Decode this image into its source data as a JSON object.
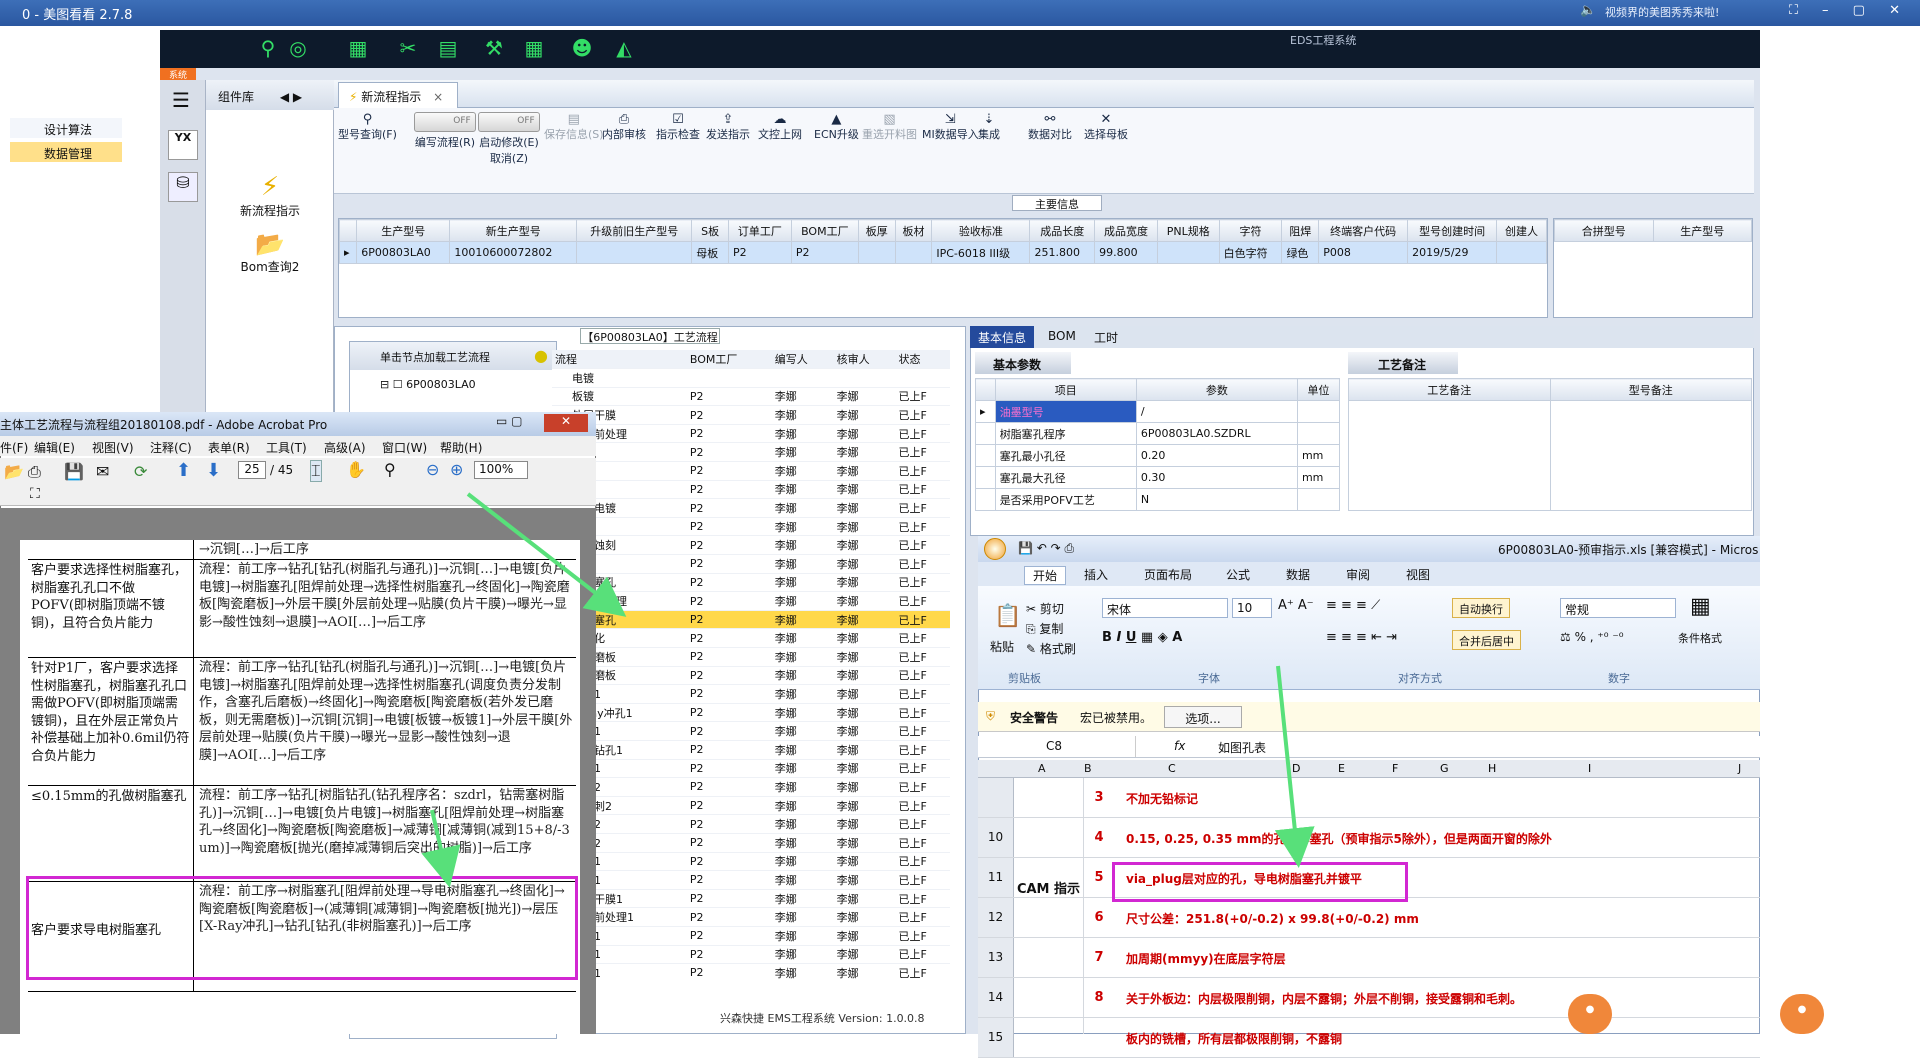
{
  "viewer": {
    "title": "0 - 美图看看 2.7.8",
    "ad_text": "视频界的美图秀秀来啦!"
  },
  "app": {
    "system_name": "EDS工程系统",
    "sys_tab": "系统",
    "status_text": "兴森快捷 EMS工程系统 Version: 1.0.0.8"
  },
  "left_nav": {
    "panel_title": "组件库",
    "items": [
      "设计算法",
      "数据管理"
    ],
    "big_buttons": [
      "新流程指示",
      "Bom查询2"
    ]
  },
  "tab": {
    "label": "新流程指示"
  },
  "ribbon": {
    "buttons": [
      {
        "label": "型号查询(F)",
        "icon": "⚲",
        "disabled": false
      },
      {
        "label": "编写流程(R)",
        "icon": "",
        "disabled": false
      },
      {
        "label": "启动修改(E)",
        "icon": "",
        "disabled": false
      },
      {
        "label": "保存信息(S)",
        "icon": "▤",
        "disabled": true
      },
      {
        "label": "内部审核",
        "icon": "⎙",
        "disabled": false
      },
      {
        "label": "指示检查",
        "icon": "☑",
        "disabled": false
      },
      {
        "label": "发送指示",
        "icon": "⇪",
        "disabled": false
      },
      {
        "label": "文控上网",
        "icon": "☁",
        "disabled": false
      },
      {
        "label": "ECN升级",
        "icon": "▲",
        "disabled": false
      },
      {
        "label": "重选开料图",
        "icon": "▧",
        "disabled": true
      },
      {
        "label": "MI数据导入",
        "icon": "⇲",
        "disabled": false
      },
      {
        "label": "集成",
        "icon": "⇣",
        "disabled": false
      },
      {
        "label": "数据对比",
        "icon": "⚯",
        "disabled": false
      },
      {
        "label": "选择母板",
        "icon": "✕",
        "disabled": false
      }
    ],
    "toggle_off": "OFF",
    "cancel_label": "取消(Z)"
  },
  "main_info": {
    "label": "主要信息",
    "columns": [
      "生产型号",
      "新生产型号",
      "升级前旧生产型号",
      "S板",
      "订单工厂",
      "BOM工厂",
      "板厚",
      "板材",
      "验收标准",
      "成品长度",
      "成品宽度",
      "PNL规格",
      "字符",
      "阻焊",
      "终端客户代码",
      "型号创建时间",
      "创建人"
    ],
    "row": [
      "6P00803LA0",
      "10010600072802",
      "",
      "母板",
      "P2",
      "P2",
      "",
      "",
      "IPC-6018 III级",
      "251.800",
      "99.800",
      "",
      "白色字符",
      "绿色",
      "P008",
      "2019/5/29",
      ""
    ],
    "merge_columns": [
      "合拼型号",
      "生产型号"
    ]
  },
  "process": {
    "title": "【6P00803LA0】工艺流程",
    "tree_header": "单击节点加载工艺流程",
    "tree_node": "6P00803LA0",
    "columns": [
      "流程",
      "BOM工厂",
      "编写人",
      "核审人",
      "状态"
    ],
    "rows": [
      [
        "电镀",
        "",
        "",
        "",
        ""
      ],
      [
        "板镀",
        "P2",
        "李娜",
        "李娜",
        "已上F"
      ],
      [
        "外层干膜",
        "P2",
        "李娜",
        "李娜",
        "已上F"
      ],
      [
        "外层前处理",
        "P2",
        "李娜",
        "李娜",
        "已上F"
      ],
      [
        "贴膜",
        "P2",
        "李娜",
        "李娜",
        "已上F"
      ],
      [
        "曝光",
        "P2",
        "李娜",
        "李娜",
        "已上F"
      ],
      [
        "显影",
        "P2",
        "李娜",
        "李娜",
        "已上F"
      ],
      [
        "图形电镀",
        "P2",
        "李娜",
        "李娜",
        "已上F"
      ],
      [
        "镀孔",
        "P2",
        "李娜",
        "李娜",
        "已上F"
      ],
      [
        "外层蚀刻",
        "P2",
        "李娜",
        "李娜",
        "已上F"
      ],
      [
        "退膜",
        "P2",
        "李娜",
        "李娜",
        "已上F"
      ],
      [
        "树脂塞孔",
        "P2",
        "李娜",
        "李娜",
        "已上F"
      ],
      [
        "阻焊前处理",
        "P2",
        "李娜",
        "李娜",
        "已上F"
      ],
      [
        "树脂塞孔",
        "P2",
        "李娜",
        "李娜",
        "已上F"
      ],
      [
        "终固化",
        "P2",
        "李娜",
        "李娜",
        "已上F"
      ],
      [
        "陶瓷磨板",
        "P2",
        "李娜",
        "李娜",
        "已上F"
      ],
      [
        "陶瓷磨板",
        "P2",
        "李娜",
        "李娜",
        "已上F"
      ],
      [
        "层压1",
        "P2",
        "李娜",
        "李娜",
        "已上F"
      ],
      [
        "X-Ray冲孔1",
        "P2",
        "李娜",
        "李娜",
        "已上F"
      ],
      [
        "钻孔1",
        "P2",
        "李娜",
        "李娜",
        "已上F"
      ],
      [
        "铝片钻孔1",
        "P2",
        "李娜",
        "李娜",
        "已上F"
      ],
      [
        "钻孔1",
        "P2",
        "李娜",
        "李娜",
        "已上F"
      ],
      [
        "沉铜2",
        "P2",
        "李娜",
        "李娜",
        "已上F"
      ],
      [
        "去毛刺2",
        "P2",
        "李娜",
        "李娜",
        "已上F"
      ],
      [
        "烘板2",
        "P2",
        "李娜",
        "李娜",
        "已上F"
      ],
      [
        "沉铜2",
        "P2",
        "李娜",
        "李娜",
        "已上F"
      ],
      [
        "电镀1",
        "P2",
        "李娜",
        "李娜",
        "已上F"
      ],
      [
        "板镀1",
        "P2",
        "李娜",
        "李娜",
        "已上F"
      ],
      [
        "外层干膜1",
        "P2",
        "李娜",
        "李娜",
        "已上F"
      ],
      [
        "外层前处理1",
        "P2",
        "李娜",
        "李娜",
        "已上F"
      ],
      [
        "贴膜1",
        "P2",
        "李娜",
        "李娜",
        "已上F"
      ],
      [
        "曝光1",
        "P2",
        "李娜",
        "李娜",
        "已上F"
      ],
      [
        "显影1",
        "P2",
        "李娜",
        "李娜",
        "已上F"
      ],
      [
        "图形电镀1",
        "P2",
        "李娜",
        "李娜",
        "已上F"
      ]
    ],
    "selected_index": 13
  },
  "right_panel": {
    "tabs": [
      "基本信息",
      "BOM",
      "工时"
    ],
    "basic_header": "基本参数",
    "craft_header": "工艺备注",
    "param_columns": [
      "项目",
      "参数",
      "单位"
    ],
    "params": [
      [
        "油墨型号",
        "/",
        ""
      ],
      [
        "树脂塞孔程序",
        "6P00803LA0.SZDRL",
        ""
      ],
      [
        "塞孔最小孔径",
        "0.20",
        "mm"
      ],
      [
        "塞孔最大孔径",
        "0.30",
        "mm"
      ],
      [
        "是否采用POFV工艺",
        "N",
        ""
      ]
    ],
    "note_columns": [
      "工艺备注",
      "型号备注"
    ]
  },
  "excel": {
    "title": "6P00803LA0-预审指示.xls [兼容模式] - Micros",
    "tabs": [
      "开始",
      "插入",
      "页面布局",
      "公式",
      "数据",
      "审阅",
      "视图"
    ],
    "ribbon": {
      "cut": "剪切",
      "copy": "复制",
      "paste": "粘贴",
      "format_painter": "格式刷",
      "font": "宋体",
      "size": "10",
      "wrap": "自动换行",
      "merge": "合并后居中",
      "number_format": "常规",
      "cond_format": "条件格式",
      "groups": [
        "剪贴板",
        "字体",
        "对齐方式",
        "数字"
      ]
    },
    "warning": {
      "label": "安全警告",
      "text": "宏已被禁用。",
      "button": "选项..."
    },
    "cell_ref": "C8",
    "formula": "如图孔表",
    "col_headers": [
      "A",
      "B",
      "C",
      "D",
      "E",
      "F",
      "G",
      "H",
      "I",
      "J"
    ],
    "cam_label": "CAM 指示",
    "rows": [
      {
        "rn": "",
        "num": "3",
        "text": "不加无铅标记"
      },
      {
        "rn": "10",
        "num": "4",
        "text": "0.15, 0.25, 0.35 mm的孔阻焊塞孔（预审指示5除外），但是两面开窗的除外"
      },
      {
        "rn": "11",
        "num": "5",
        "text": "via_plug层对应的孔，导电树脂塞孔并镀平"
      },
      {
        "rn": "12",
        "num": "6",
        "text": "尺寸公差：251.8(+0/-0.2) x 99.8(+0/-0.2) mm"
      },
      {
        "rn": "13",
        "num": "7",
        "text": "加周期(mmyy)在底层字符层"
      },
      {
        "rn": "14",
        "num": "8",
        "text": "关于外板边：内层极限削铜，内层不露铜；外层不削铜，接受露铜和毛刺。"
      },
      {
        "rn": "15",
        "num": "",
        "text": "板内的铣槽，所有层都极限削铜，不露铜"
      }
    ]
  },
  "pdf": {
    "title": "主体工艺流程与流程组20180108.pdf - Adobe Acrobat Pro",
    "menu": [
      "件(F)",
      "编辑(E)",
      "视图(V)",
      "注释(C)",
      "表单(R)",
      "工具(T)",
      "高级(A)",
      "窗口(W)",
      "帮助(H)"
    ],
    "page": "25",
    "pages": "/ 45",
    "zoom": "100%",
    "rows": [
      {
        "left": "",
        "right": "→沉铜[…]→后工序"
      },
      {
        "left": "客户要求选择性树脂塞孔，树脂塞孔孔口不做POFV(即树脂顶端不镀铜)，且符合负片能力",
        "right": "流程：前工序→钻孔[钻孔(树脂孔与通孔)]→沉铜[…]→电镀[负片电镀]→树脂塞孔[阻焊前处理→选择性树脂塞孔→终固化]→陶瓷磨板[陶瓷磨板]→外层干膜[外层前处理→贴膜(负片干膜)→曝光→显影→酸性蚀刻→退膜]→AOI[…]→后工序"
      },
      {
        "left": "针对P1厂，客户要求选择性树脂塞孔，树脂塞孔孔口需做POFV(即树脂顶端需镀铜)，且在外层正常负片补偿基础上加补0.6mil仍符合负片能力",
        "right": "流程：前工序→钻孔[钻孔(树脂孔与通孔)]→沉铜[…]→电镀[负片电镀]→树脂塞孔[阻焊前处理→选择性树脂塞孔(调度负责分发制作，含塞孔后磨板)→终固化]→陶瓷磨板[陶瓷磨板(若外发已磨板，则无需磨板)]→沉铜[沉铜]→电镀[板镀→板镀1]→外层干膜[外层前处理→贴膜(负片干膜)→曝光→显影→酸性蚀刻→退膜]→AOI[…]→后工序"
      },
      {
        "left": "≤0.15mm的孔做树脂塞孔",
        "right": "流程：前工序→钻孔[树脂钻孔(钻孔程序名：szdrl，钻需塞树脂孔)]→沉铜[…]→电镀[负片电镀]→树脂塞孔[阻焊前处理→树脂塞孔→终固化]→陶瓷磨板[陶瓷磨板]→减薄铜[减薄铜(减到15+8/-3 um)]→陶瓷磨板[抛光(磨掉减薄铜后突出的树脂)]→后工序"
      },
      {
        "left": "客户要求导电树脂塞孔",
        "right": "流程：前工序→树脂塞孔[阻焊前处理→导电树脂塞孔→终固化]→陶瓷磨板[陶瓷磨板]→(减薄铜[减薄铜]→陶瓷磨板[抛光])→层压[X-Ray冲孔]→钻孔[钻孔(非树脂塞孔)]→后工序"
      }
    ]
  },
  "colors": {
    "highlight": "#d227d2",
    "arrow": "#58e07a",
    "accent": "#244a9c",
    "excel_red": "#c00000"
  }
}
